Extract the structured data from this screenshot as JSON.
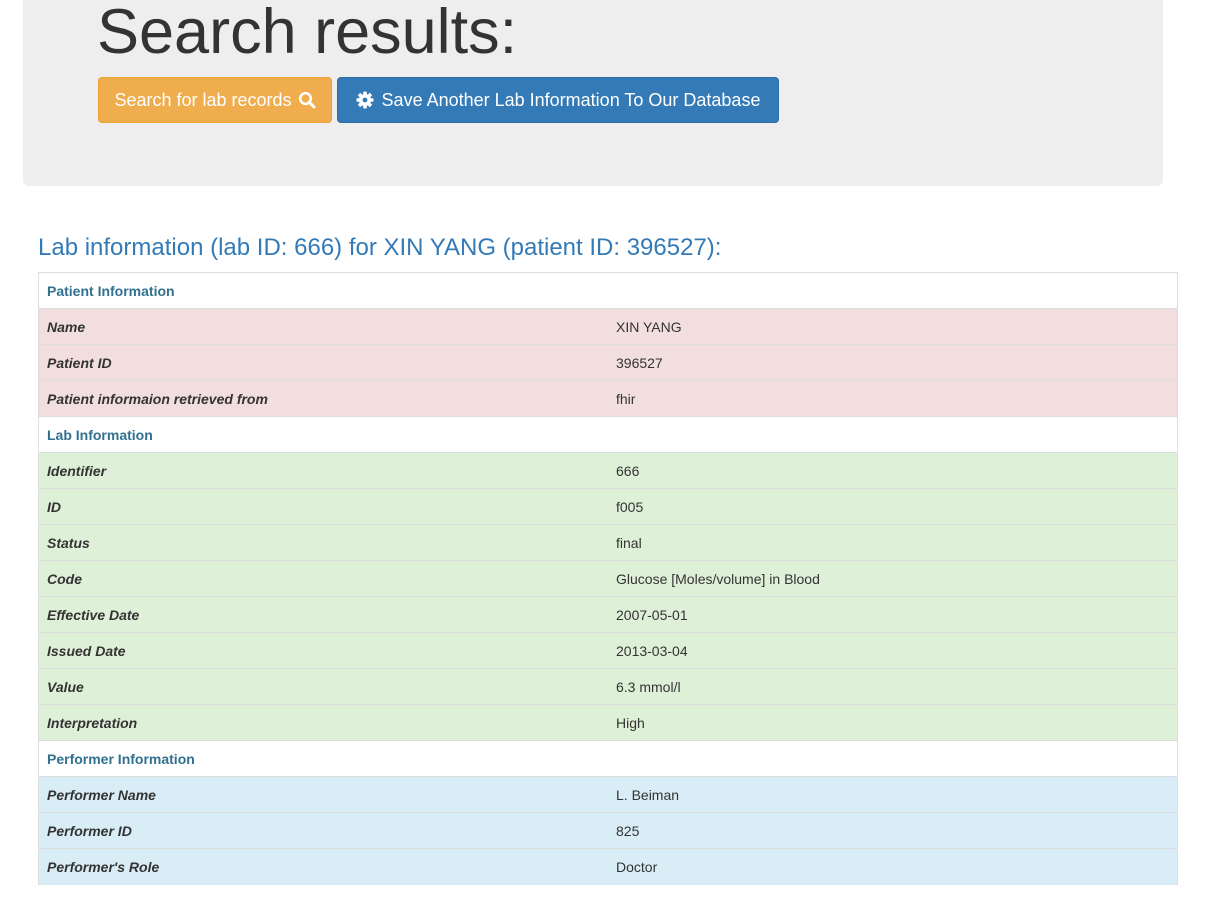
{
  "header": {
    "title": "Search results:",
    "search_button": "Search for lab records",
    "save_button": "Save Another Lab Information To Our Database"
  },
  "lab_heading": "Lab information (lab ID: 666) for XIN YANG (patient ID: 396527):",
  "sections": {
    "patient": {
      "title": "Patient Information",
      "rows": [
        {
          "label": "Name",
          "value": "XIN YANG"
        },
        {
          "label": "Patient ID",
          "value": "396527"
        },
        {
          "label": "Patient informaion retrieved from",
          "value": "fhir"
        }
      ]
    },
    "lab": {
      "title": "Lab Information",
      "rows": [
        {
          "label": "Identifier",
          "value": "666"
        },
        {
          "label": "ID",
          "value": "f005"
        },
        {
          "label": "Status",
          "value": "final"
        },
        {
          "label": "Code",
          "value": "Glucose [Moles/volume] in Blood"
        },
        {
          "label": "Effective Date",
          "value": "2007-05-01"
        },
        {
          "label": "Issued Date",
          "value": "2013-03-04"
        },
        {
          "label": "Value",
          "value": "6.3 mmol/l"
        },
        {
          "label": "Interpretation",
          "value": "High"
        }
      ]
    },
    "performer": {
      "title": "Performer Information",
      "rows": [
        {
          "label": "Performer Name",
          "value": "L. Beiman"
        },
        {
          "label": "Performer ID",
          "value": "825"
        },
        {
          "label": "Performer's Role",
          "value": "Doctor"
        }
      ]
    }
  },
  "colors": {
    "warning_button": "#f0ad4e",
    "primary_button": "#337ab7",
    "patient_rows": "#f2dede",
    "lab_rows": "#dff0d8",
    "performer_rows": "#d9edf7",
    "section_title": "#31708f"
  },
  "icons": {
    "search_button_icon": "search-icon",
    "save_button_icon": "gear-icon"
  }
}
